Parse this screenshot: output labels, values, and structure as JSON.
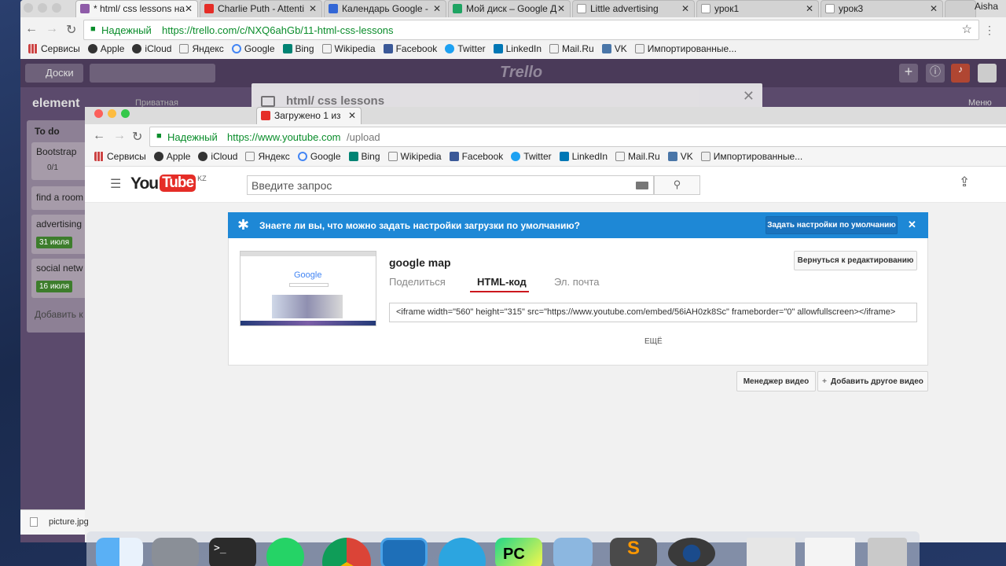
{
  "back_window": {
    "tabs": [
      {
        "title": "* html/ css lessons на",
        "color": "#8e5ba8"
      },
      {
        "title": "Charlie Puth - Attenti",
        "color": "#e52d27"
      },
      {
        "title": "Календарь Google -",
        "color": "#3367d6"
      },
      {
        "title": "Мой диск – Google Д",
        "color": "#1fa463"
      },
      {
        "title": "Little advertising",
        "color": "#ffffff"
      },
      {
        "title": "урок1",
        "color": "#ffffff"
      },
      {
        "title": "урок3",
        "color": "#ffffff"
      }
    ],
    "profile_name": "Aisha",
    "secure_label": "Надежный",
    "url": "https://trello.com/c/NXQ6ahGb/11-html-css-lessons",
    "trello": {
      "boards_label": "Доски",
      "logo": "Trello",
      "board_name": "element",
      "visibility": "Приватная",
      "menu_label": "Меню",
      "list_title": "To do",
      "cards": [
        {
          "title": "Bootstrap",
          "badge": "0/1"
        },
        {
          "title": "find a room",
          "badge": ""
        },
        {
          "title": "advertising",
          "badge": "31 июля"
        },
        {
          "title": "social netw",
          "badge": "16 июля"
        }
      ],
      "add_card": "Добавить к",
      "modal_title": "html/ css lessons"
    }
  },
  "bookmarks": [
    "Сервисы",
    "Apple",
    "iCloud",
    "Яндекс",
    "Google",
    "Bing",
    "Wikipedia",
    "Facebook",
    "Twitter",
    "LinkedIn",
    "Mail.Ru",
    "VK",
    "Импортированные..."
  ],
  "front_window": {
    "tab_title": "Загружено 1 из",
    "secure_label": "Надежный",
    "url_base": "https://www.youtube.com",
    "url_path": "/upload",
    "youtube": {
      "logo_you": "You",
      "logo_tube": "Tube",
      "logo_region": "KZ",
      "search_placeholder": "Введите запрос",
      "notice_text": "Знаете ли вы, что можно задать настройки загрузки по умолчанию?",
      "notice_button": "Задать настройки по умолчанию",
      "video_title": "google map",
      "back_to_edit": "Вернуться к редактированию",
      "tabs": [
        "Поделиться",
        "HTML-код",
        "Эл. почта"
      ],
      "active_tab": "HTML-код",
      "embed_code": "<iframe width=\"560\" height=\"315\" src=\"https://www.youtube.com/embed/56iAH0zk8Sc\" frameborder=\"0\" allowfullscreen></iframe>",
      "more_label": "ЕЩЁ",
      "video_manager": "Менеджер видео",
      "add_another": "Добавить другое видео",
      "thumbnail_logo": "Google"
    }
  },
  "download_item": "picture.jpg"
}
